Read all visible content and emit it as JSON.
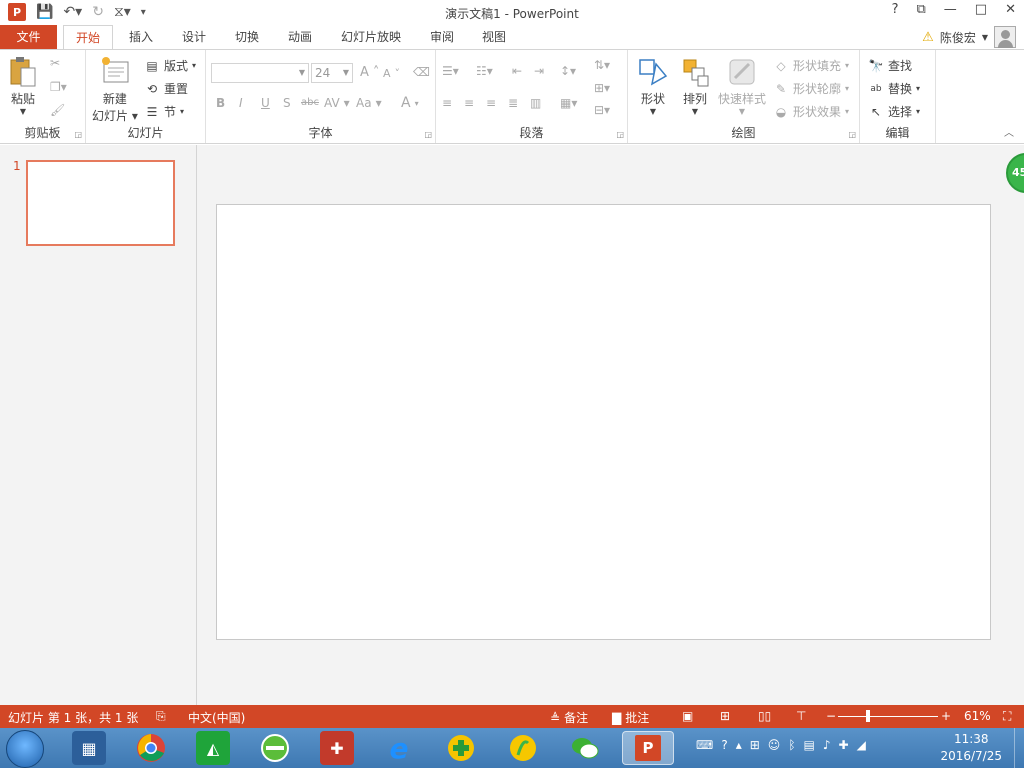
{
  "titlebar": {
    "app_logo": "P",
    "title": "演示文稿1 - PowerPoint",
    "help": "?",
    "restore": "⧉",
    "minimize": "—",
    "maximize": "□",
    "close": "✕"
  },
  "tabs": [
    "文件",
    "开始",
    "插入",
    "设计",
    "切换",
    "动画",
    "幻灯片放映",
    "审阅",
    "视图"
  ],
  "user": {
    "name": "陈俊宏",
    "warning_icon": "warning-icon"
  },
  "ribbon": {
    "clipboard": {
      "label": "剪贴板",
      "paste": "粘贴"
    },
    "slides": {
      "label": "幻灯片",
      "new_slide_line1": "新建",
      "new_slide_line2": "幻灯片",
      "layout": "版式",
      "reset": "重置",
      "section": "节"
    },
    "font": {
      "label": "字体",
      "font_name": "",
      "font_size": "24",
      "bold": "B",
      "italic": "I",
      "underline": "U",
      "shadow": "S",
      "strike": "abc",
      "spacing": "AV",
      "case": "Aa",
      "color": "A",
      "grow": "A",
      "shrink": "A"
    },
    "paragraph": {
      "label": "段落"
    },
    "drawing": {
      "label": "绘图",
      "shapes": "形状",
      "arrange": "排列",
      "quick_styles": "快速样式",
      "fill": "形状填充",
      "outline": "形状轮廓",
      "effects": "形状效果"
    },
    "editing": {
      "label": "编辑",
      "find": "查找",
      "replace": "替换",
      "select": "选择"
    }
  },
  "thumbnails": [
    {
      "number": "1"
    }
  ],
  "badge": "45",
  "statusbar": {
    "slide_info": "幻灯片 第 1 张，共 1 张",
    "language": "中文(中国)",
    "notes": "备注",
    "comments": "批注",
    "zoom": "61%",
    "zoom_minus": "−",
    "zoom_plus": "+"
  },
  "taskbar": {
    "time": "11:38",
    "date": "2016/7/25"
  },
  "colors": {
    "accent": "#d24726",
    "slide_border": "#e67a5d",
    "badge": "#3ab54a"
  }
}
